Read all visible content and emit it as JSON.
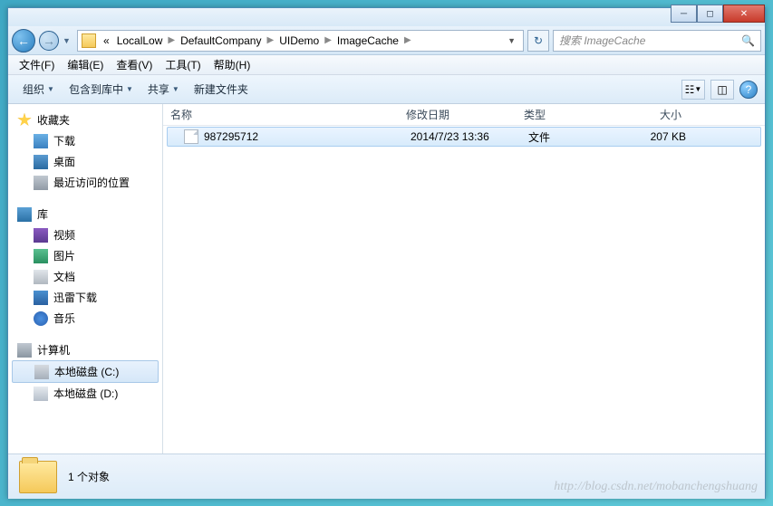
{
  "breadcrumbs": [
    "LocalLow",
    "DefaultCompany",
    "UIDemo",
    "ImageCache"
  ],
  "search_placeholder": "搜索 ImageCache",
  "menus": {
    "file": "文件(F)",
    "edit": "编辑(E)",
    "view": "查看(V)",
    "tools": "工具(T)",
    "help": "帮助(H)"
  },
  "toolbar": {
    "organize": "组织",
    "include": "包含到库中",
    "share": "共享",
    "newfolder": "新建文件夹"
  },
  "columns": {
    "name": "名称",
    "date": "修改日期",
    "type": "类型",
    "size": "大小"
  },
  "sidebar": {
    "fav": "收藏夹",
    "dl": "下载",
    "desk": "桌面",
    "recent": "最近访问的位置",
    "lib": "库",
    "vid": "视频",
    "pic": "图片",
    "doc": "文档",
    "xl": "迅雷下载",
    "mus": "音乐",
    "pc": "计算机",
    "hdc": "本地磁盘 (C:)",
    "hdd": "本地磁盘 (D:)"
  },
  "file": {
    "name": "987295712",
    "date": "2014/7/23 13:36",
    "type": "文件",
    "size": "207 KB"
  },
  "status": "1 个对象",
  "watermark": "http://blog.csdn.net/mobanchengshuang"
}
